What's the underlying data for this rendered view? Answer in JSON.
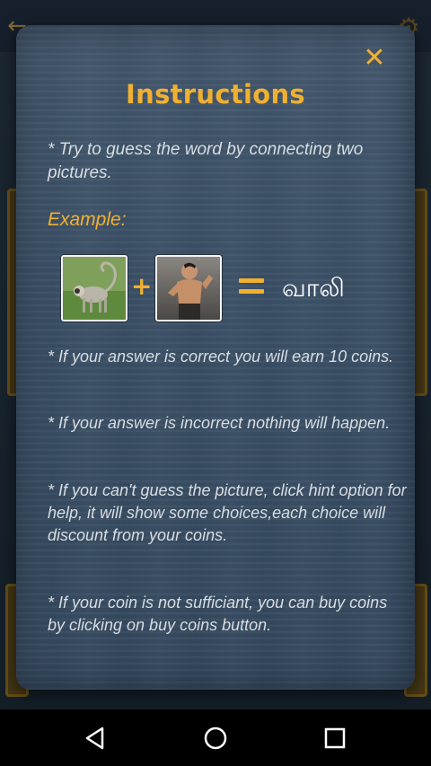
{
  "dialog": {
    "close_icon": "close-icon",
    "title": "Instructions",
    "intro": "*  Try to guess the word by connecting two pictures.",
    "example_label": "Example:",
    "example": {
      "left_image": "monkey-image",
      "operator_plus": "+",
      "right_image": "martial-artist-image",
      "operator_equals": "equals-icon",
      "answer": "வாலி"
    },
    "rules": [
      "*  If your answer is correct you will earn 10 coins.",
      "*  If your answer is incorrect nothing will happen.",
      "*  If you can't guess the picture, click hint option for help, it will show some choices,each choice will discount from your coins.",
      "*  If your coin is not sufficiant, you can buy coins by clicking on buy coins button."
    ]
  },
  "background": {
    "back_icon": "back-arrow-icon",
    "settings_icon": "gear-icon"
  },
  "navbar": {
    "back": "nav-back-icon",
    "home": "nav-home-icon",
    "recents": "nav-recents-icon"
  },
  "colors": {
    "accent": "#f0b030",
    "text": "#d8dde2",
    "panel": "#3a4f66"
  }
}
